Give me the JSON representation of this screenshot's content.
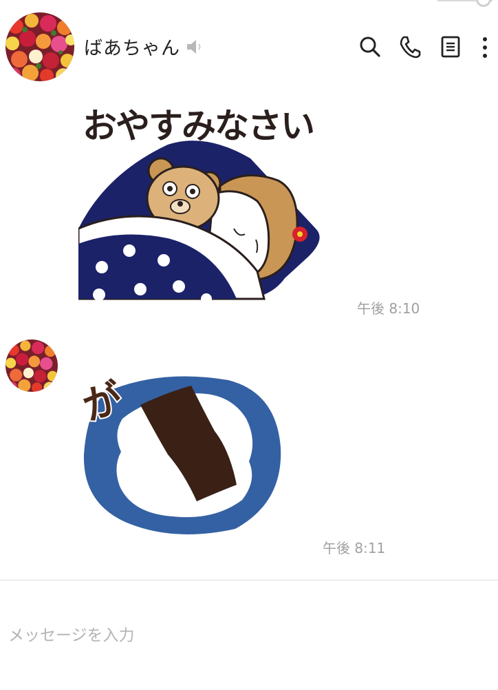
{
  "header": {
    "title": "ばあちゃん",
    "icons": [
      "speaker-muted-icon",
      "search-icon",
      "phone-icon",
      "notes-icon",
      "more-vertical-icon"
    ]
  },
  "messages": [
    {
      "sticker_text": "おやすみなさい",
      "time": "午後 8:10"
    },
    {
      "sticker_text": "が",
      "time": "午後 8:11"
    }
  ],
  "composer": {
    "placeholder": "メッセージを入力"
  },
  "colors": {
    "navy": "#1b2268",
    "blue": "#3461a3",
    "nori": "#3a2015",
    "gray_text": "#a0a0a0"
  }
}
